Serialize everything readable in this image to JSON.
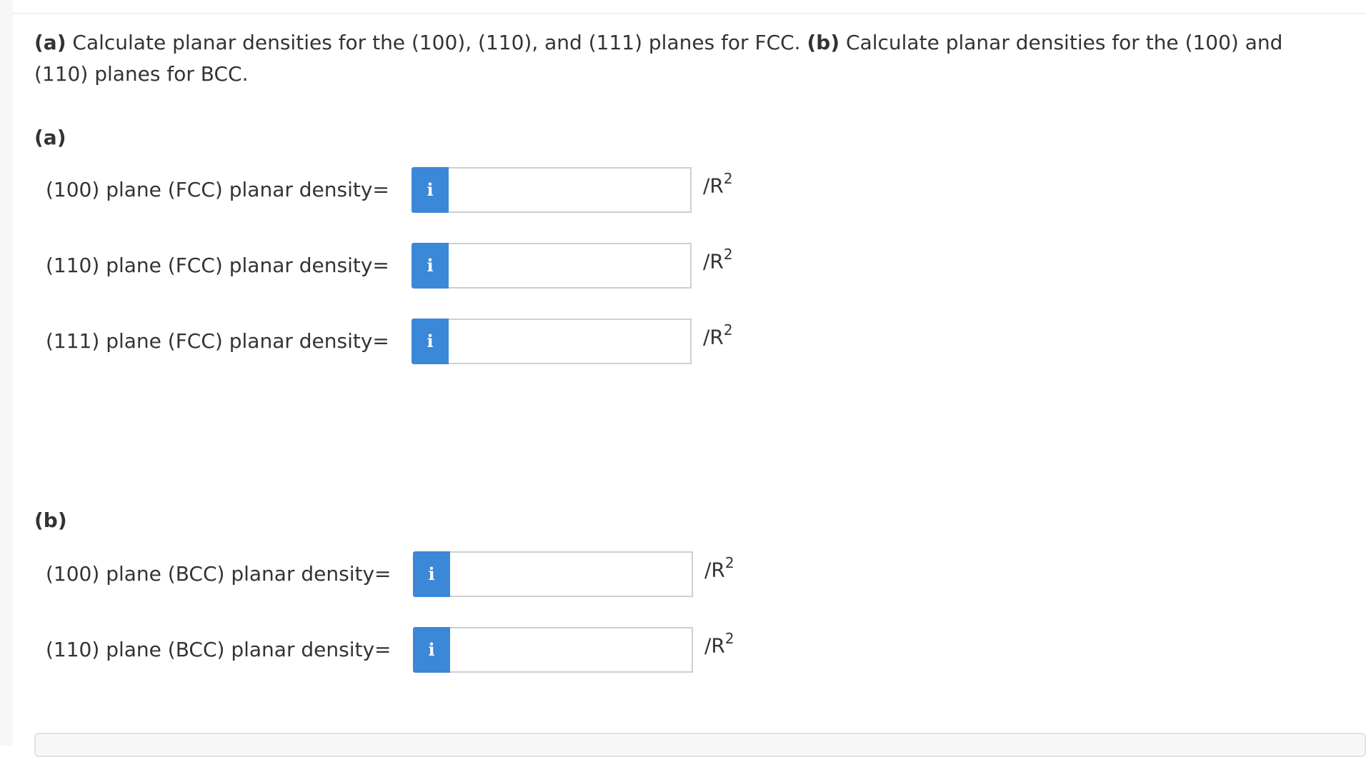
{
  "question": {
    "part_a_label": "(a)",
    "part_a_text": " Calculate planar densities for the (100), (110), and (111) planes for FCC. ",
    "part_b_label": "(b)",
    "part_b_text": " Calculate planar densities for the (100) and (110) planes for BCC."
  },
  "part_a": {
    "label": "(a)",
    "rows": [
      {
        "label": "(100) plane (FCC) planar density=",
        "info": "i",
        "value": "",
        "unit": "/R",
        "unit_exp": "2"
      },
      {
        "label": "(110) plane (FCC) planar density=",
        "info": "i",
        "value": "",
        "unit": "/R",
        "unit_exp": "2"
      },
      {
        "label": "(111) plane (FCC) planar density=",
        "info": "i",
        "value": "",
        "unit": "/R",
        "unit_exp": "2"
      }
    ]
  },
  "part_b": {
    "label": "(b)",
    "rows": [
      {
        "label": "(100) plane (BCC) planar density=",
        "info": "i",
        "value": "",
        "unit": "/R",
        "unit_exp": "2"
      },
      {
        "label": "(110) plane (BCC) planar density=",
        "info": "i",
        "value": "",
        "unit": "/R",
        "unit_exp": "2"
      }
    ]
  },
  "colors": {
    "info_button": "#3b87d8",
    "text": "#333333",
    "input_border": "#cfcfcf"
  }
}
